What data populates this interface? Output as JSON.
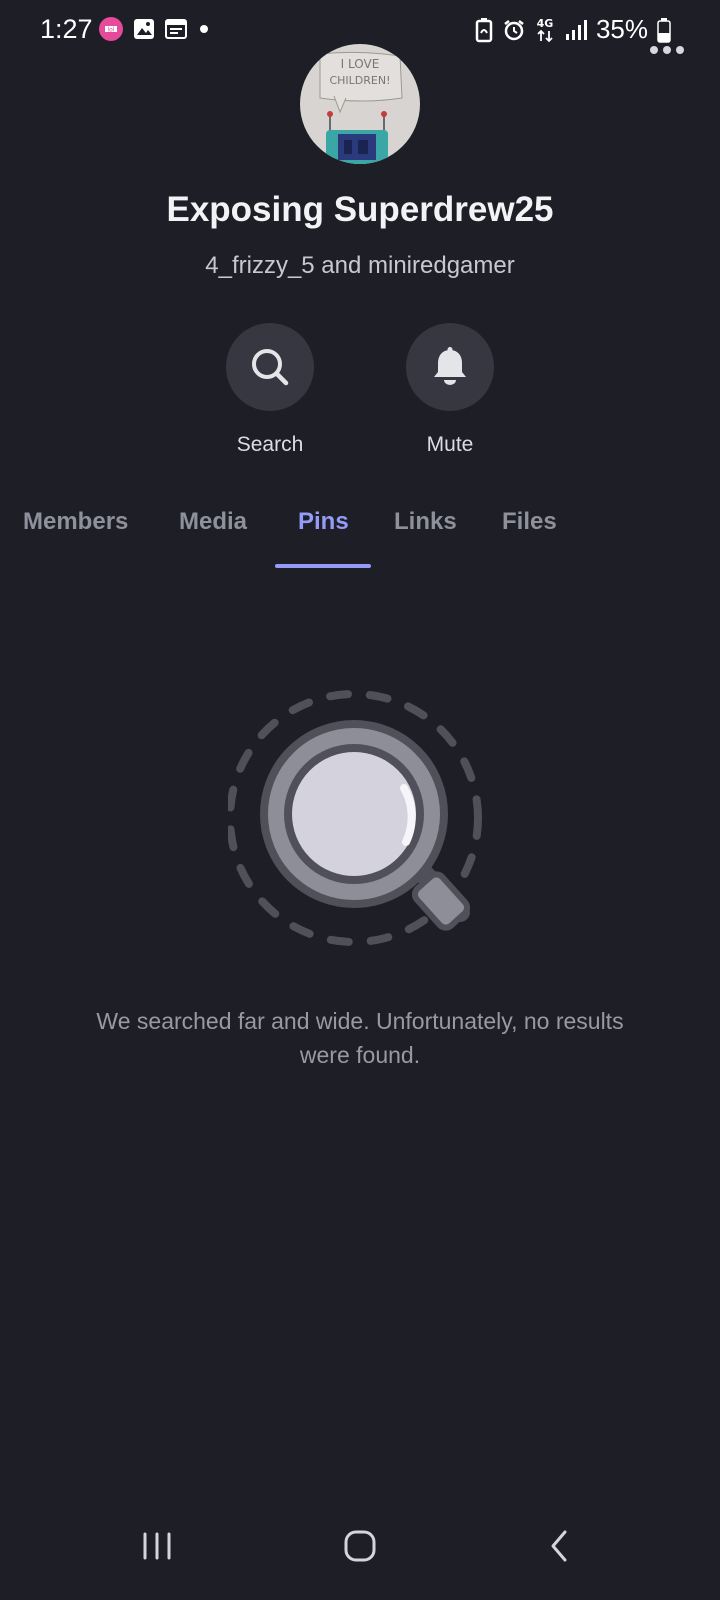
{
  "status_bar": {
    "time": "1:27",
    "battery": "35%",
    "network": "4G",
    "left_icons": [
      "app-notification-icon",
      "image-icon",
      "calendar-icon",
      "dot-icon"
    ],
    "right_icons": [
      "battery-saver-icon",
      "alarm-icon",
      "network-4g-icon",
      "signal-icon",
      "battery-icon"
    ]
  },
  "header": {
    "title": "Exposing Superdrew25",
    "subtitle": "4_frizzy_5 and miniredgamer",
    "avatar_lettering": "I LOVE CHILDREN!"
  },
  "actions": [
    {
      "label": "Search",
      "icon": "search-icon"
    },
    {
      "label": "Mute",
      "icon": "bell-icon"
    }
  ],
  "tabs": [
    {
      "label": "Members",
      "active": false
    },
    {
      "label": "Media",
      "active": false
    },
    {
      "label": "Pins",
      "active": true
    },
    {
      "label": "Links",
      "active": false
    },
    {
      "label": "Files",
      "active": false
    }
  ],
  "empty_state": {
    "icon": "magnifier-icon",
    "message": "We searched far and wide. Unfortunately, no results were found."
  },
  "nav": {
    "buttons": [
      "recents-icon",
      "home-icon",
      "back-icon"
    ]
  },
  "colors": {
    "background": "#1e1e26",
    "accent": "#949cf7",
    "button_bg": "#363740",
    "muted_text": "#8e909b"
  }
}
